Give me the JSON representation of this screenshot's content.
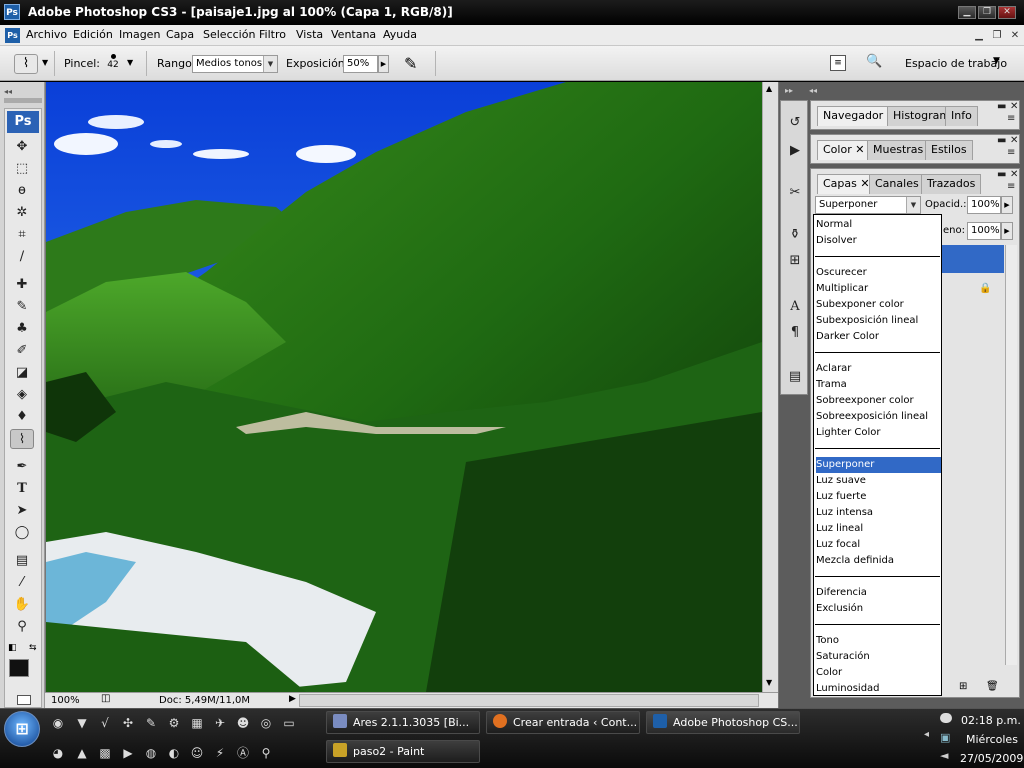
{
  "window": {
    "title": "Adobe Photoshop CS3 - [paisaje1.jpg al 100% (Capa 1, RGB/8)]",
    "app_badge": "Ps",
    "minimize": "▁",
    "restore": "❐",
    "close": "✕"
  },
  "menu": {
    "items": [
      "Archivo",
      "Edición",
      "Imagen",
      "Capa",
      "Selección",
      "Filtro",
      "Vista",
      "Ventana",
      "Ayuda"
    ],
    "doc_minimize": "▁",
    "doc_restore": "❐",
    "doc_close": "✕"
  },
  "options": {
    "brush_label": "Pincel:",
    "brush_size": "42",
    "range_label": "Rango",
    "range_value": "Medios tonos",
    "exposure_label": "Exposición:",
    "exposure_value": "50%",
    "workspace_label": "Espacio de trabajo"
  },
  "toolbox": {
    "badge": "Ps",
    "tools": [
      "move-tool",
      "marquee-tool",
      "lasso-tool",
      "magic-wand-tool",
      "crop-tool",
      "eyedropper-slice-tool",
      "healing-brush-tool",
      "brush-tool",
      "clone-stamp-tool",
      "history-brush-tool",
      "eraser-tool",
      "paint-bucket-tool",
      "blur-tool",
      "sponge-tool",
      "pen-tool",
      "type-tool",
      "path-selection-tool",
      "ellipse-tool",
      "notes-tool",
      "eyedropper-tool",
      "hand-tool",
      "zoom-tool"
    ]
  },
  "status": {
    "zoom": "100%",
    "doc_info": "Doc: 5,49M/11,0M"
  },
  "panels": {
    "group1_tabs": [
      "Navegador",
      "Histograma",
      "Info"
    ],
    "group2_tabs": [
      "Color",
      "Muestras",
      "Estilos"
    ],
    "group3_tabs": [
      "Capas",
      "Canales",
      "Trazados"
    ],
    "blend_mode": "Superponer",
    "opacity_label": "Opacid.:",
    "opacity_value": "100%",
    "fill_label": "eno:",
    "fill_value": "100%"
  },
  "blend_modes": {
    "groups": [
      [
        "Normal",
        "Disolver"
      ],
      [
        "Oscurecer",
        "Multiplicar",
        "Subexponer color",
        "Subexposición lineal",
        "Darker Color"
      ],
      [
        "Aclarar",
        "Trama",
        "Sobreexponer color",
        "Sobreexposición lineal",
        "Lighter Color"
      ],
      [
        "Superponer",
        "Luz suave",
        "Luz fuerte",
        "Luz intensa",
        "Luz lineal",
        "Luz focal",
        "Mezcla definida"
      ],
      [
        "Diferencia",
        "Exclusión"
      ],
      [
        "Tono",
        "Saturación",
        "Color",
        "Luminosidad"
      ]
    ],
    "selected": "Superponer"
  },
  "taskbar": {
    "tasks_row1": [
      "Ares 2.1.1.3035  [Bi...",
      "Crear entrada ‹ Cont...",
      "Adobe Photoshop CS..."
    ],
    "tasks_row2": [
      "paso2 - Paint"
    ],
    "time": "02:18 p.m.",
    "day": "Miércoles",
    "date": "27/05/2009"
  },
  "colors": {
    "accent": "#3169c6",
    "titlebar": "#000000",
    "panel_bg": "#e4e4e4"
  }
}
